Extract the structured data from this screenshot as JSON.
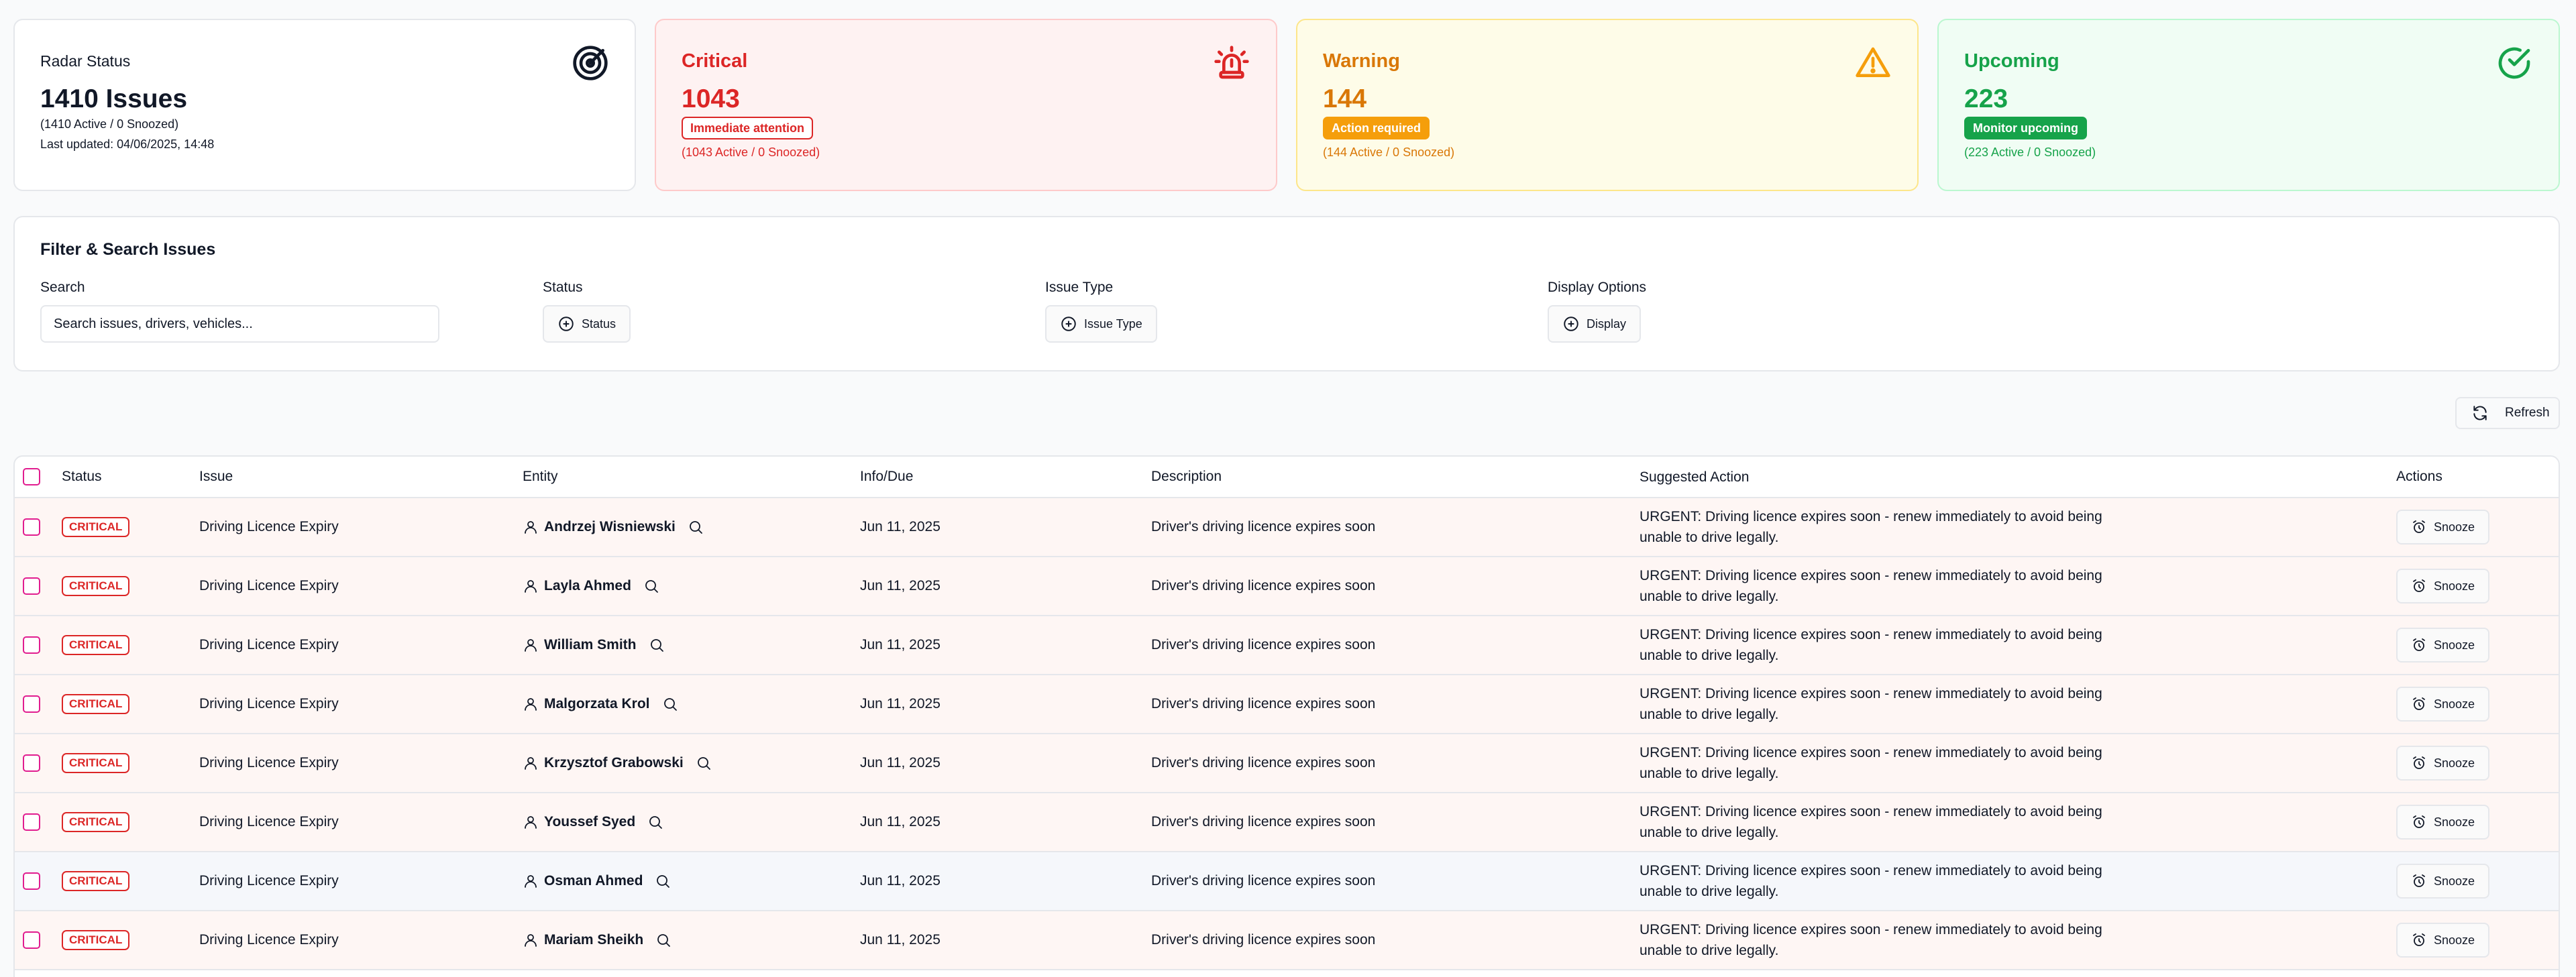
{
  "cards": {
    "radar": {
      "title": "Radar Status",
      "big": "1410 Issues",
      "line1": "(1410 Active / 0 Snoozed)",
      "line2": "Last updated: 04/06/2025, 14:48",
      "icon": "radar-icon"
    },
    "critical": {
      "title": "Critical",
      "big": "1043",
      "tag": "Immediate attention",
      "line": "(1043 Active / 0 Snoozed)",
      "icon": "siren-icon",
      "color": "#dc2626"
    },
    "warning": {
      "title": "Warning",
      "big": "144",
      "tag": "Action required",
      "line": "(144 Active / 0 Snoozed)",
      "icon": "warning-triangle-icon",
      "color": "#d97706"
    },
    "upcoming": {
      "title": "Upcoming",
      "big": "223",
      "tag": "Monitor upcoming",
      "line": "(223 Active / 0 Snoozed)",
      "icon": "check-circle-icon",
      "color": "#16a34a"
    }
  },
  "filter": {
    "title": "Filter & Search Issues",
    "search_label": "Search",
    "search_placeholder": "Search issues, drivers, vehicles...",
    "status_label": "Status",
    "status_button": "Status",
    "issue_type_label": "Issue Type",
    "issue_type_button": "Issue Type",
    "display_label": "Display Options",
    "display_button": "Display"
  },
  "refresh_label": "Refresh",
  "table": {
    "headers": {
      "status": "Status",
      "issue": "Issue",
      "entity": "Entity",
      "info": "Info/Due",
      "description": "Description",
      "suggested": "Suggested Action",
      "actions": "Actions"
    },
    "rows": [
      {
        "status": "CRITICAL",
        "issue": "Driving Licence Expiry",
        "entity": "Andrzej Wisniewski",
        "due": "Jun 11, 2025",
        "description": "Driver's driving licence expires soon",
        "suggested": "URGENT: Driving licence expires soon - renew immediately to avoid being unable to drive legally.",
        "action": "Snooze"
      },
      {
        "status": "CRITICAL",
        "issue": "Driving Licence Expiry",
        "entity": "Layla Ahmed",
        "due": "Jun 11, 2025",
        "description": "Driver's driving licence expires soon",
        "suggested": "URGENT: Driving licence expires soon - renew immediately to avoid being unable to drive legally.",
        "action": "Snooze"
      },
      {
        "status": "CRITICAL",
        "issue": "Driving Licence Expiry",
        "entity": "William Smith",
        "due": "Jun 11, 2025",
        "description": "Driver's driving licence expires soon",
        "suggested": "URGENT: Driving licence expires soon - renew immediately to avoid being unable to drive legally.",
        "action": "Snooze"
      },
      {
        "status": "CRITICAL",
        "issue": "Driving Licence Expiry",
        "entity": "Malgorzata Krol",
        "due": "Jun 11, 2025",
        "description": "Driver's driving licence expires soon",
        "suggested": "URGENT: Driving licence expires soon - renew immediately to avoid being unable to drive legally.",
        "action": "Snooze"
      },
      {
        "status": "CRITICAL",
        "issue": "Driving Licence Expiry",
        "entity": "Krzysztof Grabowski",
        "due": "Jun 11, 2025",
        "description": "Driver's driving licence expires soon",
        "suggested": "URGENT: Driving licence expires soon - renew immediately to avoid being unable to drive legally.",
        "action": "Snooze"
      },
      {
        "status": "CRITICAL",
        "issue": "Driving Licence Expiry",
        "entity": "Youssef Syed",
        "due": "Jun 11, 2025",
        "description": "Driver's driving licence expires soon",
        "suggested": "URGENT: Driving licence expires soon - renew immediately to avoid being unable to drive legally.",
        "action": "Snooze"
      },
      {
        "status": "CRITICAL",
        "issue": "Driving Licence Expiry",
        "entity": "Osman Ahmed",
        "due": "Jun 11, 2025",
        "description": "Driver's driving licence expires soon",
        "suggested": "URGENT: Driving licence expires soon - renew immediately to avoid being unable to drive legally.",
        "action": "Snooze"
      },
      {
        "status": "CRITICAL",
        "issue": "Driving Licence Expiry",
        "entity": "Mariam Sheikh",
        "due": "Jun 11, 2025",
        "description": "Driver's driving licence expires soon",
        "suggested": "URGENT: Driving licence expires soon - renew immediately to avoid being unable to drive legally.",
        "action": "Snooze"
      }
    ]
  }
}
